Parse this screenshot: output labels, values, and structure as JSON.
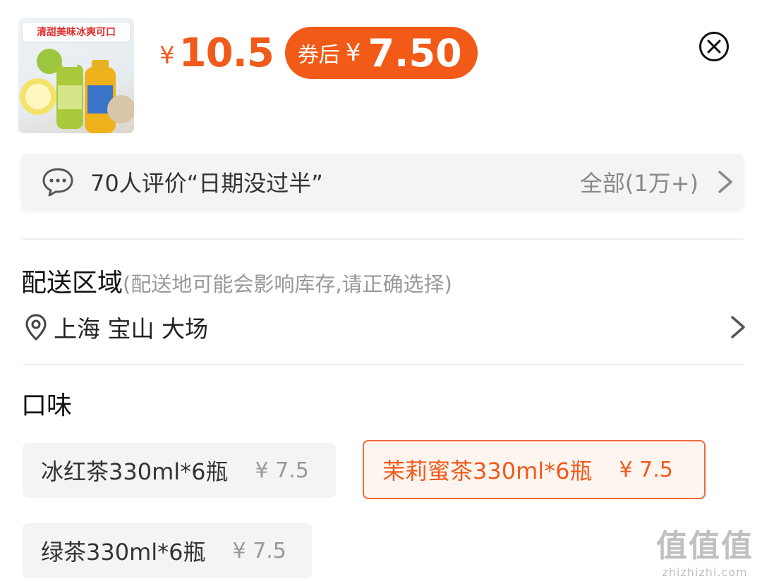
{
  "product": {
    "thumbnail_banner": "清甜美味冰爽可口",
    "currency_symbol": "¥",
    "price": "10.5",
    "coupon_label": "券后",
    "coupon_price": "7.50"
  },
  "review_bar": {
    "text": "70人评价“日期没过半”",
    "all_label": "全部(1万+)"
  },
  "delivery": {
    "title": "配送区域",
    "hint": "(配送地可能会影响库存,请正确选择)",
    "location": "上海 宝山 大场"
  },
  "flavor": {
    "title": "口味",
    "options": [
      {
        "name": "冰红茶330ml*6瓶",
        "price": "¥ 7.5",
        "selected": false
      },
      {
        "name": "茉莉蜜茶330ml*6瓶",
        "price": "¥ 7.5",
        "selected": true
      },
      {
        "name": "绿茶330ml*6瓶",
        "price": "¥ 7.5",
        "selected": false
      }
    ]
  },
  "watermark": {
    "big": "值值值",
    "small": "zhizhizhi.com"
  },
  "colors": {
    "accent": "#f05a1a",
    "coupon_bg": "#f25a17",
    "muted_text": "#999999",
    "panel_bg": "#f4f4f4"
  }
}
